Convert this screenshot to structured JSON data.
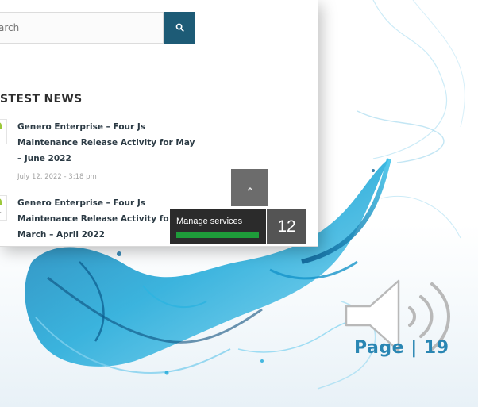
{
  "search": {
    "placeholder": "arch"
  },
  "news": {
    "heading": "STEST NEWS",
    "items": [
      {
        "title_lines": [
          "Genero Enterprise – Four Js",
          "Maintenance Release Activity for May",
          "– June 2022"
        ],
        "date": "July 12, 2022 - 3:18 pm",
        "thumb_text": "m."
      },
      {
        "title_lines": [
          "Genero Enterprise – Four Js",
          "Maintenance Release Activity fo",
          "March – April 2022"
        ],
        "thumb_text": "m."
      }
    ]
  },
  "manage_services": {
    "label": "Manage services",
    "count": "12"
  },
  "footer": {
    "page_label": "Page | 19"
  },
  "icons": {
    "search": "search-icon",
    "scroll_top": "chevron-up-icon",
    "speaker": "speaker-icon"
  },
  "colors": {
    "search_button": "#1d5b76",
    "manage_bar": "#1e9c3a",
    "page_number": "#2a86b3"
  }
}
